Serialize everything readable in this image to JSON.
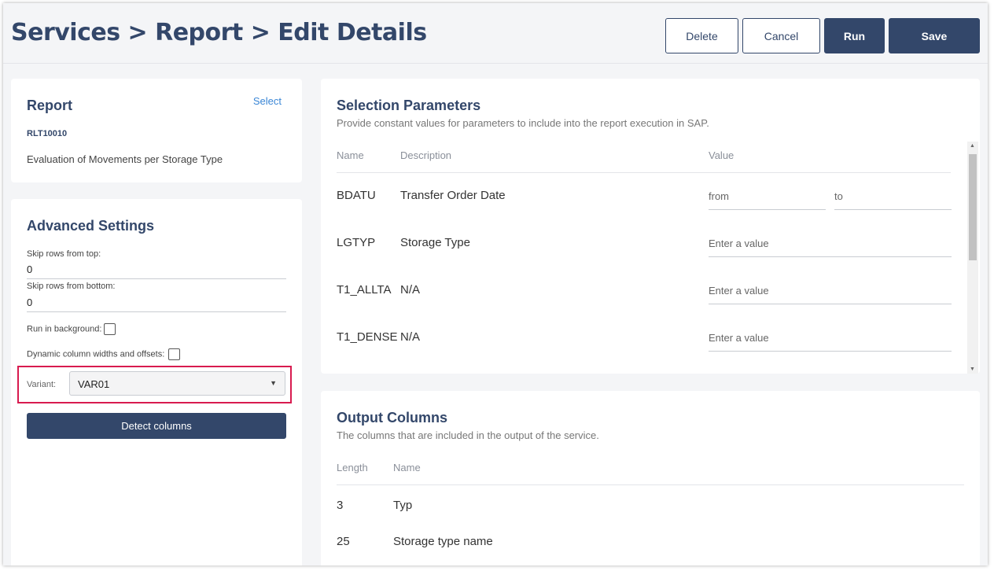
{
  "header": {
    "title": "Services > Report > Edit Details",
    "buttons": {
      "delete": "Delete",
      "cancel": "Cancel",
      "run": "Run",
      "save": "Save"
    }
  },
  "report": {
    "title": "Report",
    "select_link": "Select",
    "code": "RLT10010",
    "description": "Evaluation of Movements per Storage Type"
  },
  "advanced": {
    "title": "Advanced Settings",
    "skip_top_label": "Skip rows from top:",
    "skip_top_value": "0",
    "skip_bottom_label": "Skip rows from bottom:",
    "skip_bottom_value": "0",
    "run_background_label": "Run in background:",
    "dynamic_widths_label": "Dynamic column widths and offsets:",
    "variant_label": "Variant:",
    "variant_value": "VAR01",
    "detect_button": "Detect columns",
    "highlight_color": "#d81b4f"
  },
  "selection": {
    "title": "Selection Parameters",
    "subtitle": "Provide constant values for parameters to include into the report execution in SAP.",
    "columns": {
      "name": "Name",
      "description": "Description",
      "value": "Value"
    },
    "rows": [
      {
        "name": "BDATU",
        "description": "Transfer Order Date",
        "from_placeholder": "from",
        "to_placeholder": "to"
      },
      {
        "name": "LGTYP",
        "description": "Storage Type",
        "placeholder": "Enter a value"
      },
      {
        "name": "T1_ALLTA",
        "description": "N/A",
        "placeholder": "Enter a value"
      },
      {
        "name": "T1_DENSE",
        "description": "N/A",
        "placeholder": "Enter a value"
      }
    ]
  },
  "output": {
    "title": "Output Columns",
    "subtitle": "The columns that are included in the output of the service.",
    "columns": {
      "length": "Length",
      "name": "Name"
    },
    "rows": [
      {
        "length": "3",
        "name": "Typ"
      },
      {
        "length": "25",
        "name": "Storage type name"
      }
    ]
  },
  "colors": {
    "primary": "#33476a",
    "link": "#3a86d6",
    "background": "#f4f5f7"
  }
}
